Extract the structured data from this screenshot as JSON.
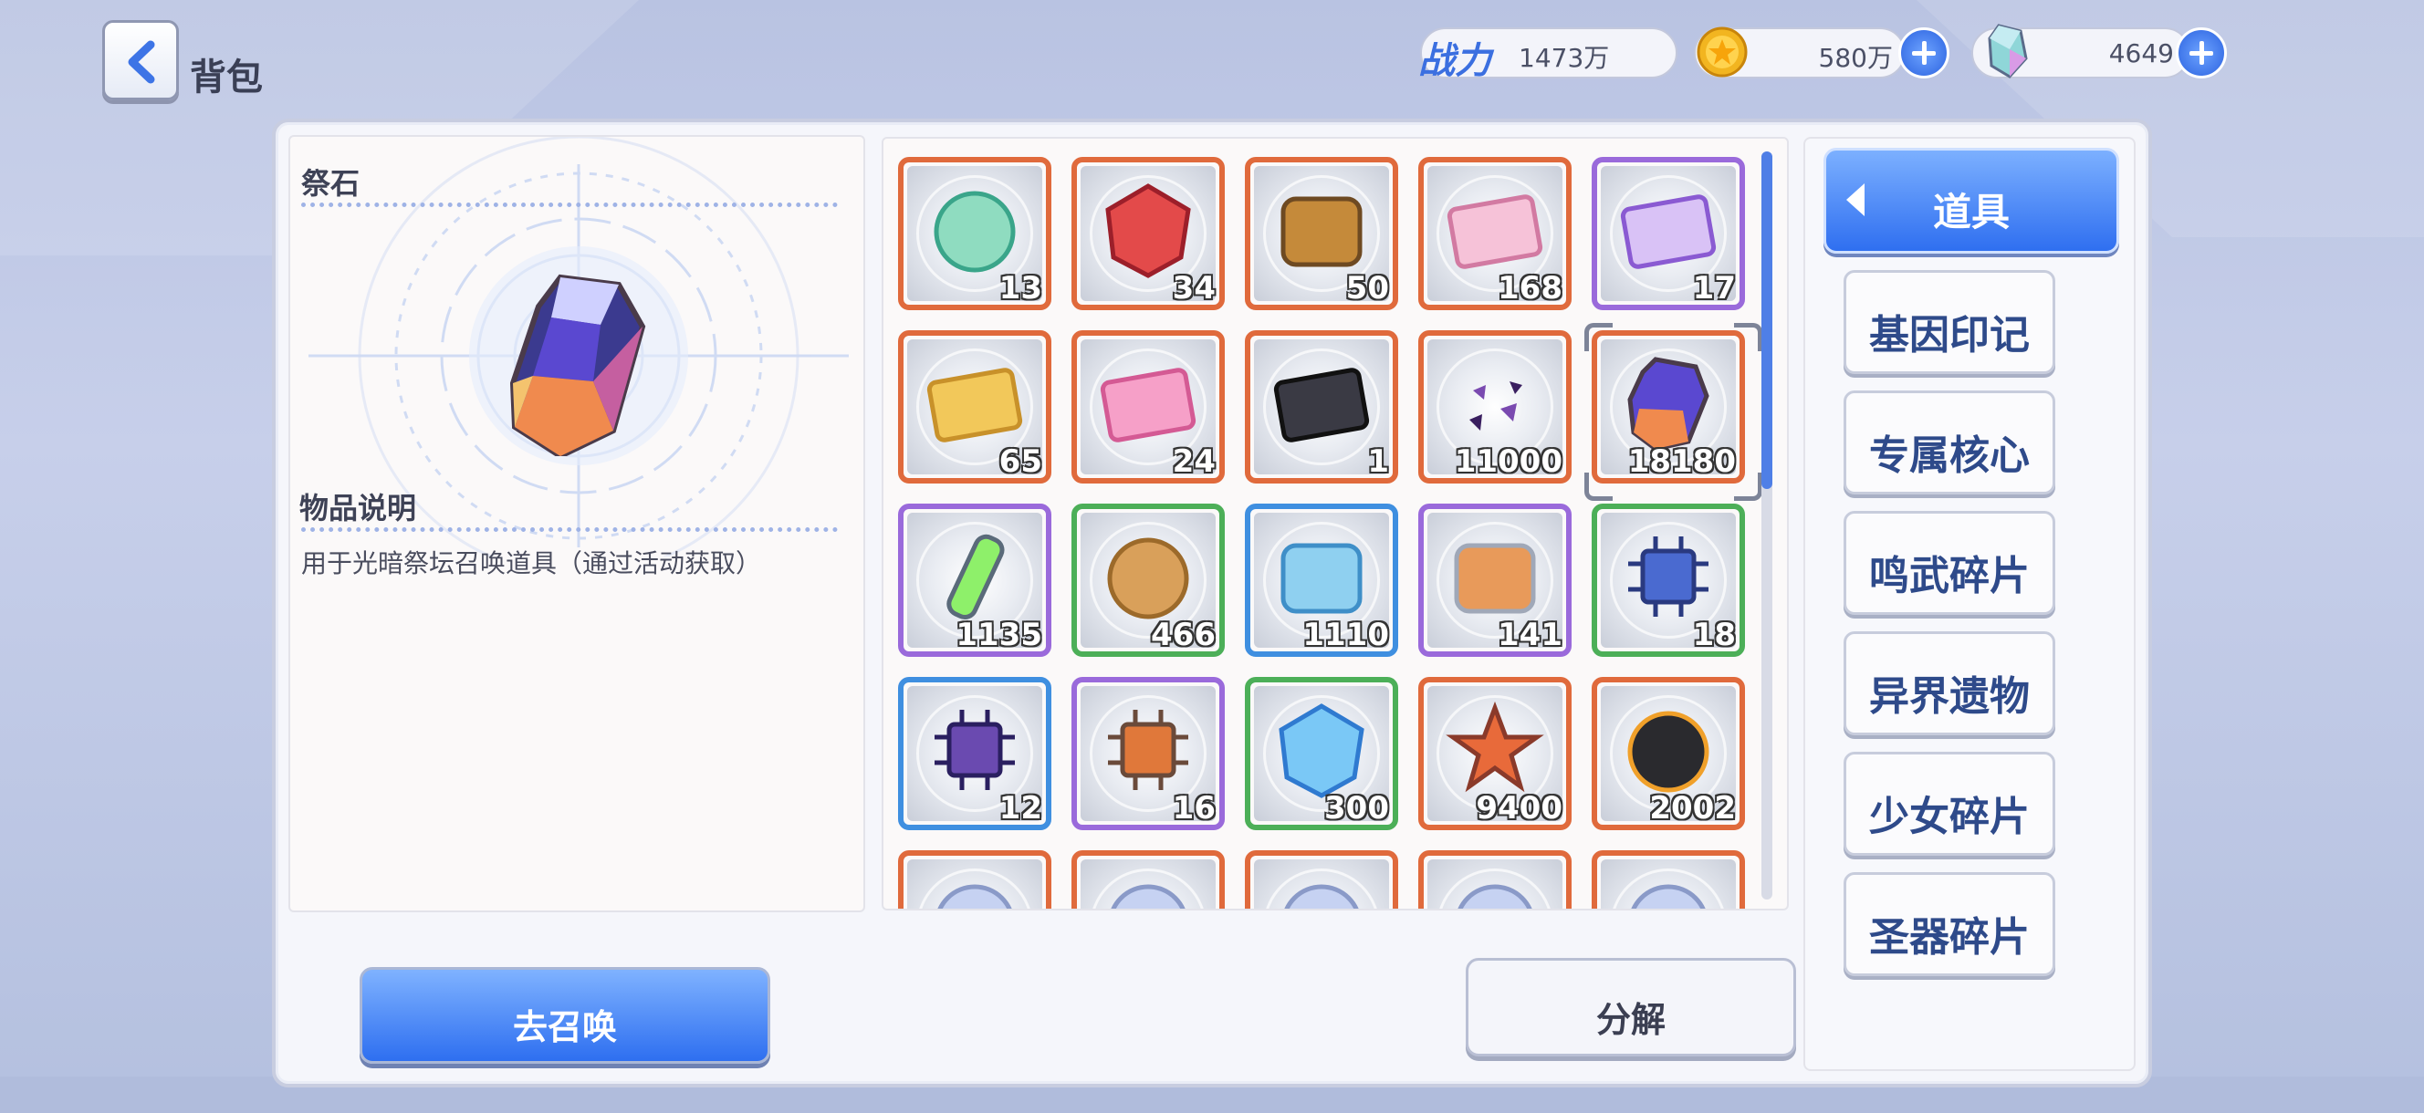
{
  "header": {
    "title": "背包",
    "back_icon": "chevron-left-icon",
    "power_label": "战力",
    "power_value": "1473万",
    "gold_value": "580万",
    "gem_value": "4649"
  },
  "item_detail": {
    "name": "祭石",
    "description_heading": "物品说明",
    "description": "用于光暗祭坛召唤道具（通过活动获取）"
  },
  "items": [
    {
      "count": "13",
      "rarity": "orange",
      "icon": "green-orb-icon"
    },
    {
      "count": "34",
      "rarity": "orange",
      "icon": "red-crystal-cube-icon"
    },
    {
      "count": "50",
      "rarity": "orange",
      "icon": "treasure-chest-icon"
    },
    {
      "count": "168",
      "rarity": "orange",
      "icon": "pink-ticket-icon"
    },
    {
      "count": "17",
      "rarity": "purple",
      "icon": "purple-ticket-icon"
    },
    {
      "count": "65",
      "rarity": "orange",
      "icon": "gold-card-icon"
    },
    {
      "count": "24",
      "rarity": "orange",
      "icon": "gene-card-icon"
    },
    {
      "count": "1",
      "rarity": "orange",
      "icon": "black-card-icon"
    },
    {
      "count": "11000",
      "rarity": "orange",
      "icon": "purple-shards-icon"
    },
    {
      "count": "18180",
      "rarity": "orange",
      "icon": "sacred-stone-icon"
    },
    {
      "count": "1135",
      "rarity": "purple",
      "icon": "green-vial-icon"
    },
    {
      "count": "466",
      "rarity": "green",
      "icon": "cookie-icon"
    },
    {
      "count": "1110",
      "rarity": "blue",
      "icon": "candy-icon"
    },
    {
      "count": "141",
      "rarity": "purple",
      "icon": "can-icon"
    },
    {
      "count": "18",
      "rarity": "green",
      "icon": "blue-chip-icon"
    },
    {
      "count": "12",
      "rarity": "blue",
      "icon": "purple-chip-icon"
    },
    {
      "count": "16",
      "rarity": "purple",
      "icon": "orange-chip-icon"
    },
    {
      "count": "300",
      "rarity": "green",
      "icon": "ice-crystal-icon"
    },
    {
      "count": "9400",
      "rarity": "orange",
      "icon": "star-medal-icon"
    },
    {
      "count": "2002",
      "rarity": "orange",
      "icon": "ghost-icon"
    },
    {
      "count": "",
      "rarity": "orange",
      "icon": "partial-icon"
    },
    {
      "count": "",
      "rarity": "orange",
      "icon": "partial-icon"
    },
    {
      "count": "",
      "rarity": "orange",
      "icon": "partial-icon"
    },
    {
      "count": "",
      "rarity": "orange",
      "icon": "partial-icon"
    },
    {
      "count": "",
      "rarity": "orange",
      "icon": "partial-icon"
    }
  ],
  "categories": {
    "active": "道具",
    "list": [
      "基因印记",
      "专属核心",
      "鸣武碎片",
      "异界遗物",
      "少女碎片",
      "圣器碎片"
    ]
  },
  "buttons": {
    "summon": "去召唤",
    "decompose": "分解"
  },
  "colors": {
    "accent": "#2f6ff0",
    "orange_frame": "#e06a3c",
    "purple_frame": "#9a6adb",
    "green_frame": "#4caf58",
    "blue_frame": "#3f8fe0"
  }
}
